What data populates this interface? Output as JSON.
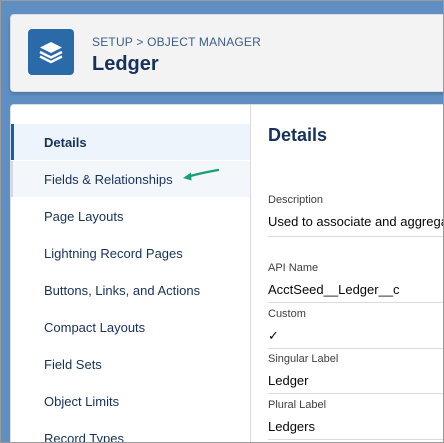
{
  "header": {
    "breadcrumb": "SETUP > OBJECT MANAGER",
    "title": "Ledger",
    "icon": "layers-icon",
    "icon_bg": "#2b6aa8"
  },
  "sidebar": {
    "items": [
      {
        "label": "Details"
      },
      {
        "label": "Fields & Relationships"
      },
      {
        "label": "Page Layouts"
      },
      {
        "label": "Lightning Record Pages"
      },
      {
        "label": "Buttons, Links, and Actions"
      },
      {
        "label": "Compact Layouts"
      },
      {
        "label": "Field Sets"
      },
      {
        "label": "Object Limits"
      },
      {
        "label": "Record Types"
      }
    ],
    "active_index": 0,
    "highlight_index": 1,
    "annotation": "green-arrow-icon",
    "annotation_color": "#1a9e7a"
  },
  "details": {
    "heading": "Details",
    "fields": [
      {
        "label": "Description",
        "value": "Used to associate and aggrega"
      },
      {
        "label": "API Name",
        "value": "AcctSeed__Ledger__c"
      },
      {
        "label": "Custom",
        "value": "✓"
      },
      {
        "label": "Singular Label",
        "value": "Ledger"
      },
      {
        "label": "Plural Label",
        "value": "Ledgers"
      }
    ]
  },
  "colors": {
    "background": "#5f8fc2",
    "accent": "#1b5ea8",
    "title_text": "#16325c"
  }
}
